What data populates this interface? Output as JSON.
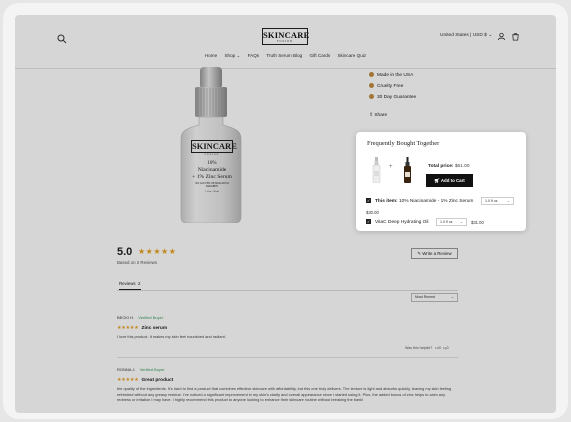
{
  "header": {
    "logo_text": "SKINCARE",
    "logo_sub": "FUSION",
    "country": "United States | USD $",
    "nav": [
      "Home",
      "Shop",
      "FAQs",
      "Truth Serum Blog",
      "Gift Cards",
      "Skincare Quiz"
    ]
  },
  "product": {
    "label_brand": "SKINCARE",
    "label_sub": "FUSION",
    "label_pct": "10%",
    "label_name": "Niacinamide",
    "label_name2": "+ 1% Zinc Serum",
    "label_claims": "NO GLUTEN, PETROLATUM",
    "label_claims2": "PARABEN",
    "label_size": "1 fl oz / 30 ml",
    "features": [
      "Made in the USA",
      "Cruelty Free",
      "30 Day Guarantee"
    ],
    "share_label": "Share"
  },
  "reviews": {
    "average": "5.0",
    "stars": "★★★★★",
    "based_on": "Based on 2 Reviews",
    "write_label": "Write a Review",
    "tab_label": "Reviews",
    "tab_count": "2",
    "sort_label": "Most Recent",
    "items": [
      {
        "name": "BECKI H.",
        "verified": "Verified Buyer",
        "stars": "★★★★★",
        "title": "Zinc serum",
        "body": "I love this product. It makes my skin feel nourished and radiant.",
        "helpful": "Was this helpful?",
        "up": "0",
        "down": "0"
      },
      {
        "name": "RONNA J.",
        "verified": "Verified Buyer",
        "stars": "★★★★★",
        "title": "Great product",
        "body": "the quality of the ingredients. It's hard to find a product that combines effective skincare with affordability, but this one truly delivers. The texture is light and absorbs quickly, leaving my skin feeling refreshed without any greasy residue. I've noticed a significant improvement in my skin's clarity and overall appearance since I started using it. Plus, the added bonus of zinc helps to calm any redness or irritation I may have. I highly recommend this product to anyone looking to enhance their skincare routine without breaking the bank!"
      }
    ]
  },
  "popup": {
    "title": "Frequently Bought Together",
    "plus": "+",
    "total_label": "Total price:",
    "total_value": "$61.00",
    "add_to_cart": "Add to Cart",
    "items": [
      {
        "prefix": "This item:",
        "name": "10% Niacinamide - 1% Zinc Serum",
        "variant": "1.0 fl oz",
        "price": "$30.00"
      },
      {
        "prefix": "",
        "name": "VitaC Deep Hydrating Oil",
        "variant": "1.0 fl oz",
        "price": "$31.00"
      }
    ]
  },
  "colors": {
    "star": "#e8a11f",
    "verified": "#3a9d5a",
    "overlay": "rgba(0,0,0,0.16)"
  }
}
